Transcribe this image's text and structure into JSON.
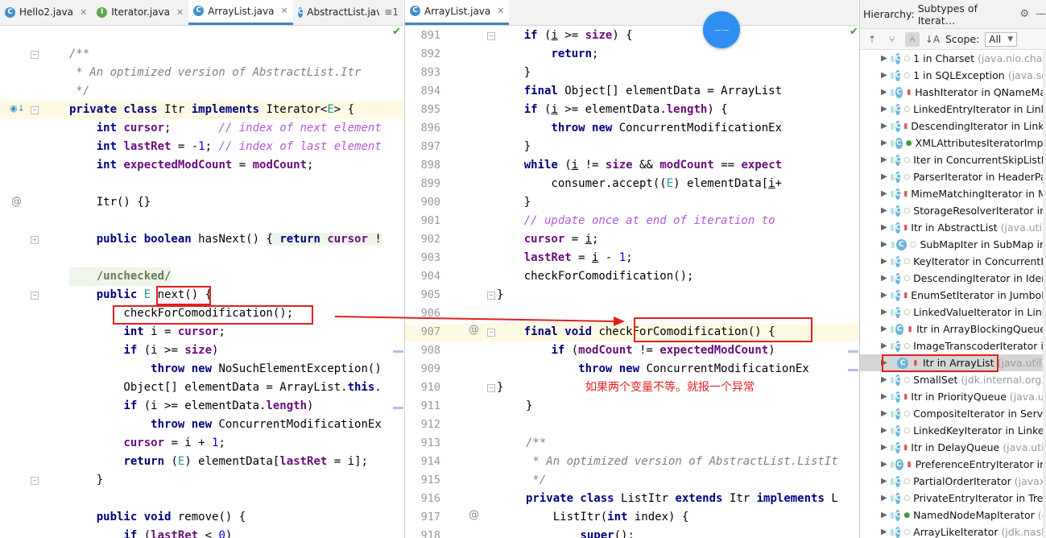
{
  "left_editor": {
    "tabs": [
      {
        "label": "Hello2.java",
        "icon": "C",
        "active": false
      },
      {
        "label": "Iterator.java",
        "icon": "I",
        "active": false
      },
      {
        "label": "ArrayList.java",
        "icon": "C",
        "active": true
      },
      {
        "label": "AbstractList.java",
        "icon": "C",
        "active": false
      }
    ],
    "tab_overflow": "≡1",
    "lines": [
      "/**",
      " * An optimized version of AbstractList.Itr",
      " */",
      "private class Itr implements Iterator<E> {",
      "    int cursor;       // index of next element",
      "    int lastRet = -1; // index of last element",
      "    int expectedModCount = modCount;",
      "",
      "    Itr() {}",
      "",
      "    public boolean hasNext() { return cursor !",
      "",
      "    /unchecked/",
      "    public E next() {",
      "        checkForComodification();",
      "        int i = cursor;",
      "        if (i >= size)",
      "            throw new NoSuchElementException()",
      "        Object[] elementData = ArrayList.this.",
      "        if (i >= elementData.length)",
      "            throw new ConcurrentModificationEx",
      "        cursor = i + 1;",
      "        return (E) elementData[lastRet = i];",
      "    }",
      "",
      "    public void remove() {",
      "        if (lastRet < 0)"
    ]
  },
  "right_editor": {
    "tab": {
      "label": "ArrayList.java",
      "icon": "C"
    },
    "line_numbers": [
      "891",
      "892",
      "893",
      "894",
      "895",
      "896",
      "897",
      "898",
      "899",
      "900",
      "901",
      "902",
      "903",
      "904",
      "905",
      "906",
      "907",
      "908",
      "909",
      "910",
      "911",
      "912",
      "913",
      "914",
      "915",
      "916",
      "917",
      "918"
    ],
    "lines": [
      "    if (i >= size) {",
      "        return;",
      "    }",
      "    final Object[] elementData = ArrayList",
      "    if (i >= elementData.length) {",
      "        throw new ConcurrentModificationEx",
      "    }",
      "    while (i != size && modCount == expect",
      "        consumer.accept((E) elementData[i+",
      "    }",
      "    // update once at end of iteration to",
      "    cursor = i;",
      "    lastRet = i - 1;",
      "    checkForComodification();",
      "}",
      "",
      "final void checkForComodification() {",
      "    if (modCount != expectedModCount)",
      "        throw new ConcurrentModificationEx",
      "}",
      "}",
      "",
      "/**",
      " * An optimized version of AbstractList.ListIt",
      " */",
      "private class ListItr extends Itr implements L",
      "    ListItr(int index) {",
      "        super();"
    ],
    "annotation": "如果两个变量不等。就报一个异常"
  },
  "hierarchy": {
    "title": "Hierarchy:",
    "subtitle": "Subtypes of Iterat…",
    "scope_label": "Scope:",
    "scope_value": "All",
    "items": [
      {
        "name": "1 in Charset",
        "pkg": "(java.nio.charse",
        "vis": "pkg"
      },
      {
        "name": "1 in SQLException",
        "pkg": "(java.sql",
        "vis": "pkg"
      },
      {
        "name": "HashIterator in QNameMa",
        "pkg": "",
        "vis": "lock"
      },
      {
        "name": "LinkedEntryIterator in Link",
        "pkg": "",
        "vis": "pkg"
      },
      {
        "name": "DescendingIterator in Linke",
        "pkg": "",
        "vis": "lock"
      },
      {
        "name": "XMLAttributesIteratorImpl",
        "pkg": "",
        "vis": "pub"
      },
      {
        "name": "Iter in ConcurrentSkipListM",
        "pkg": "",
        "vis": "pkg"
      },
      {
        "name": "ParserIterator in HeaderPa",
        "pkg": "",
        "vis": "pkg"
      },
      {
        "name": "MimeMatchingIterator in M",
        "pkg": "",
        "vis": "lock"
      },
      {
        "name": "StorageResolverIterator in",
        "pkg": "",
        "vis": "pkg"
      },
      {
        "name": "Itr in AbstractList",
        "pkg": "(java.util)",
        "vis": "lock"
      },
      {
        "name": "SubMapIter in SubMap in",
        "pkg": "",
        "vis": "pkg"
      },
      {
        "name": "KeyIterator in ConcurrentH",
        "pkg": "",
        "vis": "pkg"
      },
      {
        "name": "DescendingIterator in Iden",
        "pkg": "",
        "vis": "pkg"
      },
      {
        "name": "EnumSetIterator in JumboE",
        "pkg": "",
        "vis": "lock"
      },
      {
        "name": "LinkedValueIterator in Link",
        "pkg": "",
        "vis": "pkg"
      },
      {
        "name": "Itr in ArrayBlockingQueue",
        "pkg": "",
        "vis": "lock"
      },
      {
        "name": "ImageTranscoderIterator in",
        "pkg": "",
        "vis": "pkg"
      },
      {
        "name": "Itr in ArrayList",
        "pkg": "(java.util)",
        "vis": "lock",
        "selected": true
      },
      {
        "name": "SmallSet",
        "pkg": "(jdk.internal.org.o",
        "vis": "pkg"
      },
      {
        "name": "Itr in PriorityQueue",
        "pkg": "(java.ut",
        "vis": "lock"
      },
      {
        "name": "CompositeIterator in Servic",
        "pkg": "",
        "vis": "pkg"
      },
      {
        "name": "LinkedKeyIterator in Linked",
        "pkg": "",
        "vis": "pkg"
      },
      {
        "name": "Itr in DelayQueue",
        "pkg": "(java.util.",
        "vis": "lock"
      },
      {
        "name": "PreferenceEntryIterator in",
        "pkg": "",
        "vis": "lock"
      },
      {
        "name": "PartialOrderIterator",
        "pkg": "(javax.",
        "vis": "pkg"
      },
      {
        "name": "PrivateEntryIterator in Tree",
        "pkg": "",
        "vis": "pkg"
      },
      {
        "name": "NamedNodeMapIterator",
        "pkg": "(com.",
        "vis": "pub"
      },
      {
        "name": "ArrayLikeIterator",
        "pkg": "(jdk.nash",
        "vis": "pkg"
      }
    ]
  },
  "colors": {
    "annotation_red": "#e02020",
    "keyword": "#000080",
    "field": "#660e7a",
    "comment": "#808080"
  }
}
